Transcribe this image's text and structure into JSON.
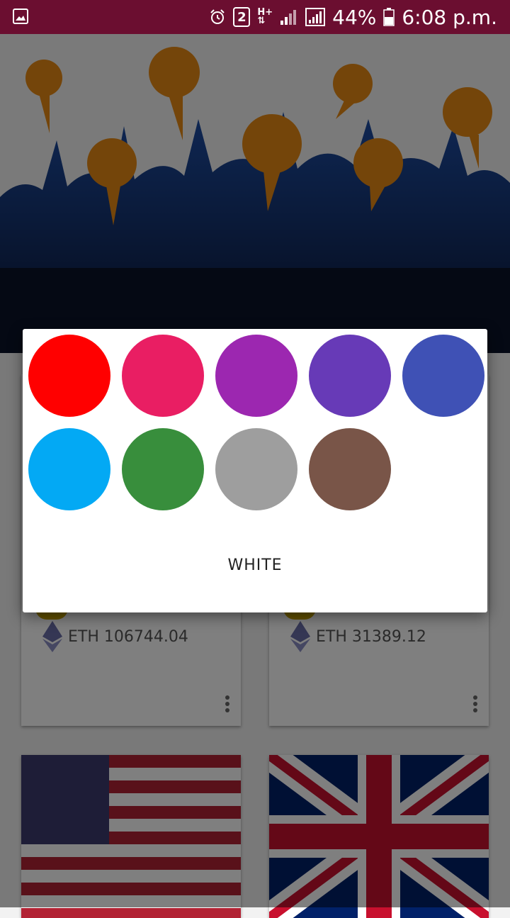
{
  "status_bar": {
    "icons": [
      "gallery-icon",
      "alarm-icon",
      "sim-badge-icon",
      "hplus-icon",
      "signal-icon",
      "signal-icon",
      "battery-icon"
    ],
    "sim_badge": "2",
    "network": "H+",
    "battery": "44%",
    "time": "6:08 p.m."
  },
  "cards": [
    {
      "eth": "ETH 106744.04"
    },
    {
      "eth": "ETH 31389.12"
    }
  ],
  "dialog": {
    "colors": [
      {
        "name": "red",
        "hex": "#ff0000"
      },
      {
        "name": "pink",
        "hex": "#e91e63"
      },
      {
        "name": "purple",
        "hex": "#9c27b0"
      },
      {
        "name": "deep-purple",
        "hex": "#673ab7"
      },
      {
        "name": "indigo",
        "hex": "#3f51b5"
      },
      {
        "name": "light-blue",
        "hex": "#03a9f4"
      },
      {
        "name": "green",
        "hex": "#388e3c"
      },
      {
        "name": "grey",
        "hex": "#9e9e9e"
      },
      {
        "name": "brown",
        "hex": "#795548"
      }
    ],
    "white_label": "WHITE"
  }
}
